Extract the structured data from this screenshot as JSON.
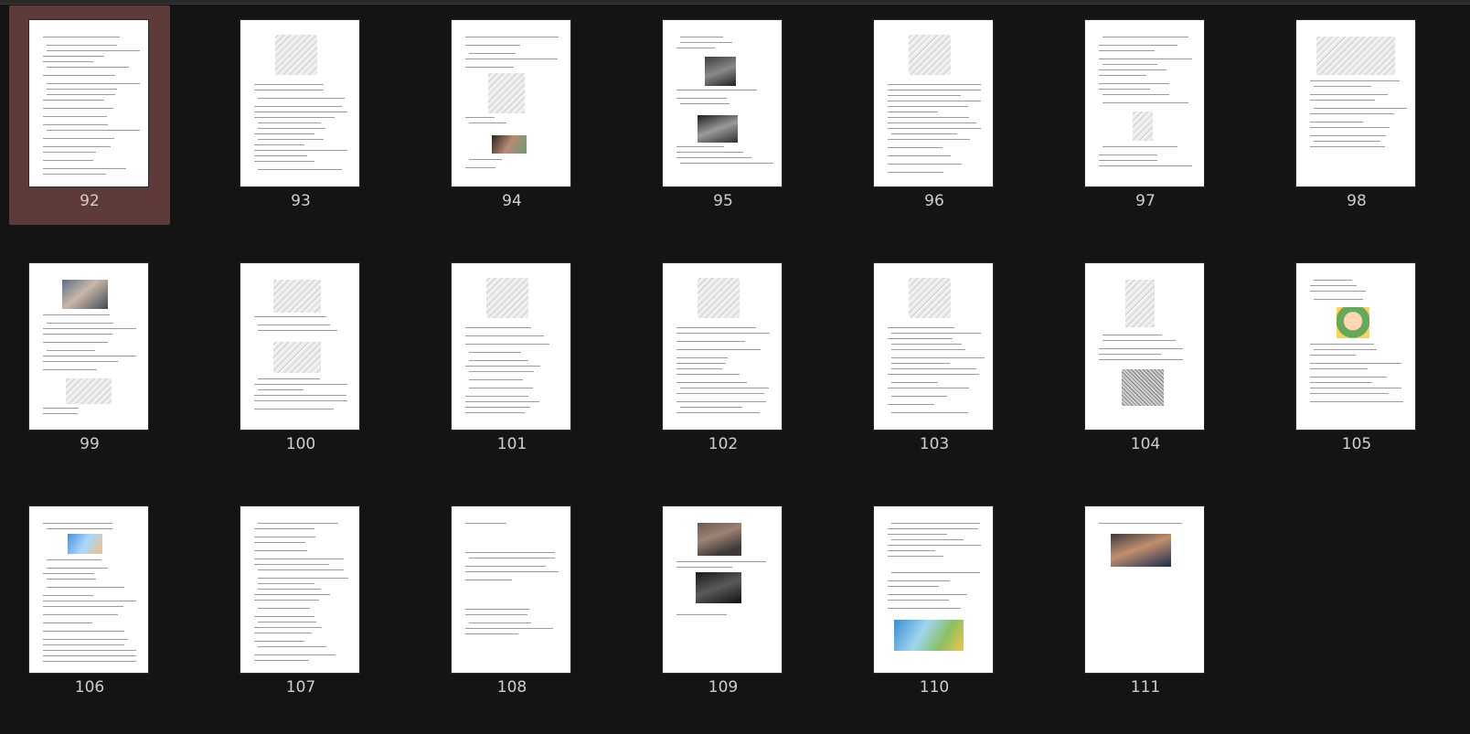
{
  "viewer": {
    "pages": [
      {
        "number": "92",
        "selected": true,
        "layout": "text"
      },
      {
        "number": "93",
        "selected": false,
        "layout": "sketch-top"
      },
      {
        "number": "94",
        "selected": false,
        "layout": "text-images"
      },
      {
        "number": "95",
        "selected": false,
        "layout": "photo-mid"
      },
      {
        "number": "96",
        "selected": false,
        "layout": "sketch-top"
      },
      {
        "number": "97",
        "selected": false,
        "layout": "text-small-image"
      },
      {
        "number": "98",
        "selected": false,
        "layout": "comic-top"
      },
      {
        "number": "99",
        "selected": false,
        "layout": "photo-top"
      },
      {
        "number": "100",
        "selected": false,
        "layout": "two-sketches"
      },
      {
        "number": "101",
        "selected": false,
        "layout": "sketch-top"
      },
      {
        "number": "102",
        "selected": false,
        "layout": "sketch-top"
      },
      {
        "number": "103",
        "selected": false,
        "layout": "sketch-top"
      },
      {
        "number": "104",
        "selected": false,
        "layout": "sketch-comic"
      },
      {
        "number": "105",
        "selected": false,
        "layout": "cartoon"
      },
      {
        "number": "106",
        "selected": false,
        "layout": "small-color-top"
      },
      {
        "number": "107",
        "selected": false,
        "layout": "text"
      },
      {
        "number": "108",
        "selected": false,
        "layout": "sparse-text"
      },
      {
        "number": "109",
        "selected": false,
        "layout": "two-photos"
      },
      {
        "number": "110",
        "selected": false,
        "layout": "social-landscape"
      },
      {
        "number": "111",
        "selected": false,
        "layout": "video-photo"
      }
    ]
  },
  "colors": {
    "background": "#141414",
    "selection": "#5e3b39",
    "page": "#ffffff",
    "label": "#cfcfcf"
  }
}
